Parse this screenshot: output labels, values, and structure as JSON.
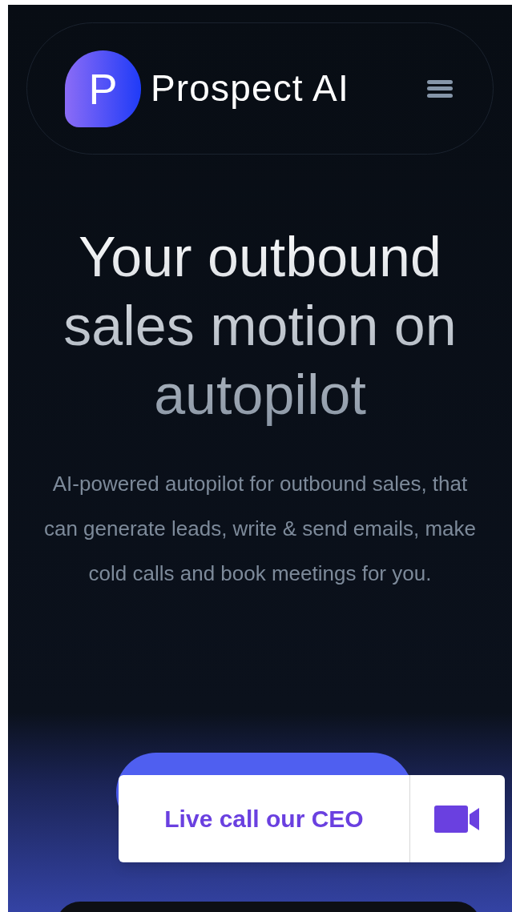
{
  "header": {
    "logo_letter": "P",
    "brand": "Prospect AI"
  },
  "hero": {
    "headline": "Your outbound sales motion on autopilot",
    "description": "AI-powered autopilot for outbound sales, that can generate leads, write & send emails, make cold calls and book meetings for you."
  },
  "cta": {
    "label": "Live call our CEO"
  }
}
